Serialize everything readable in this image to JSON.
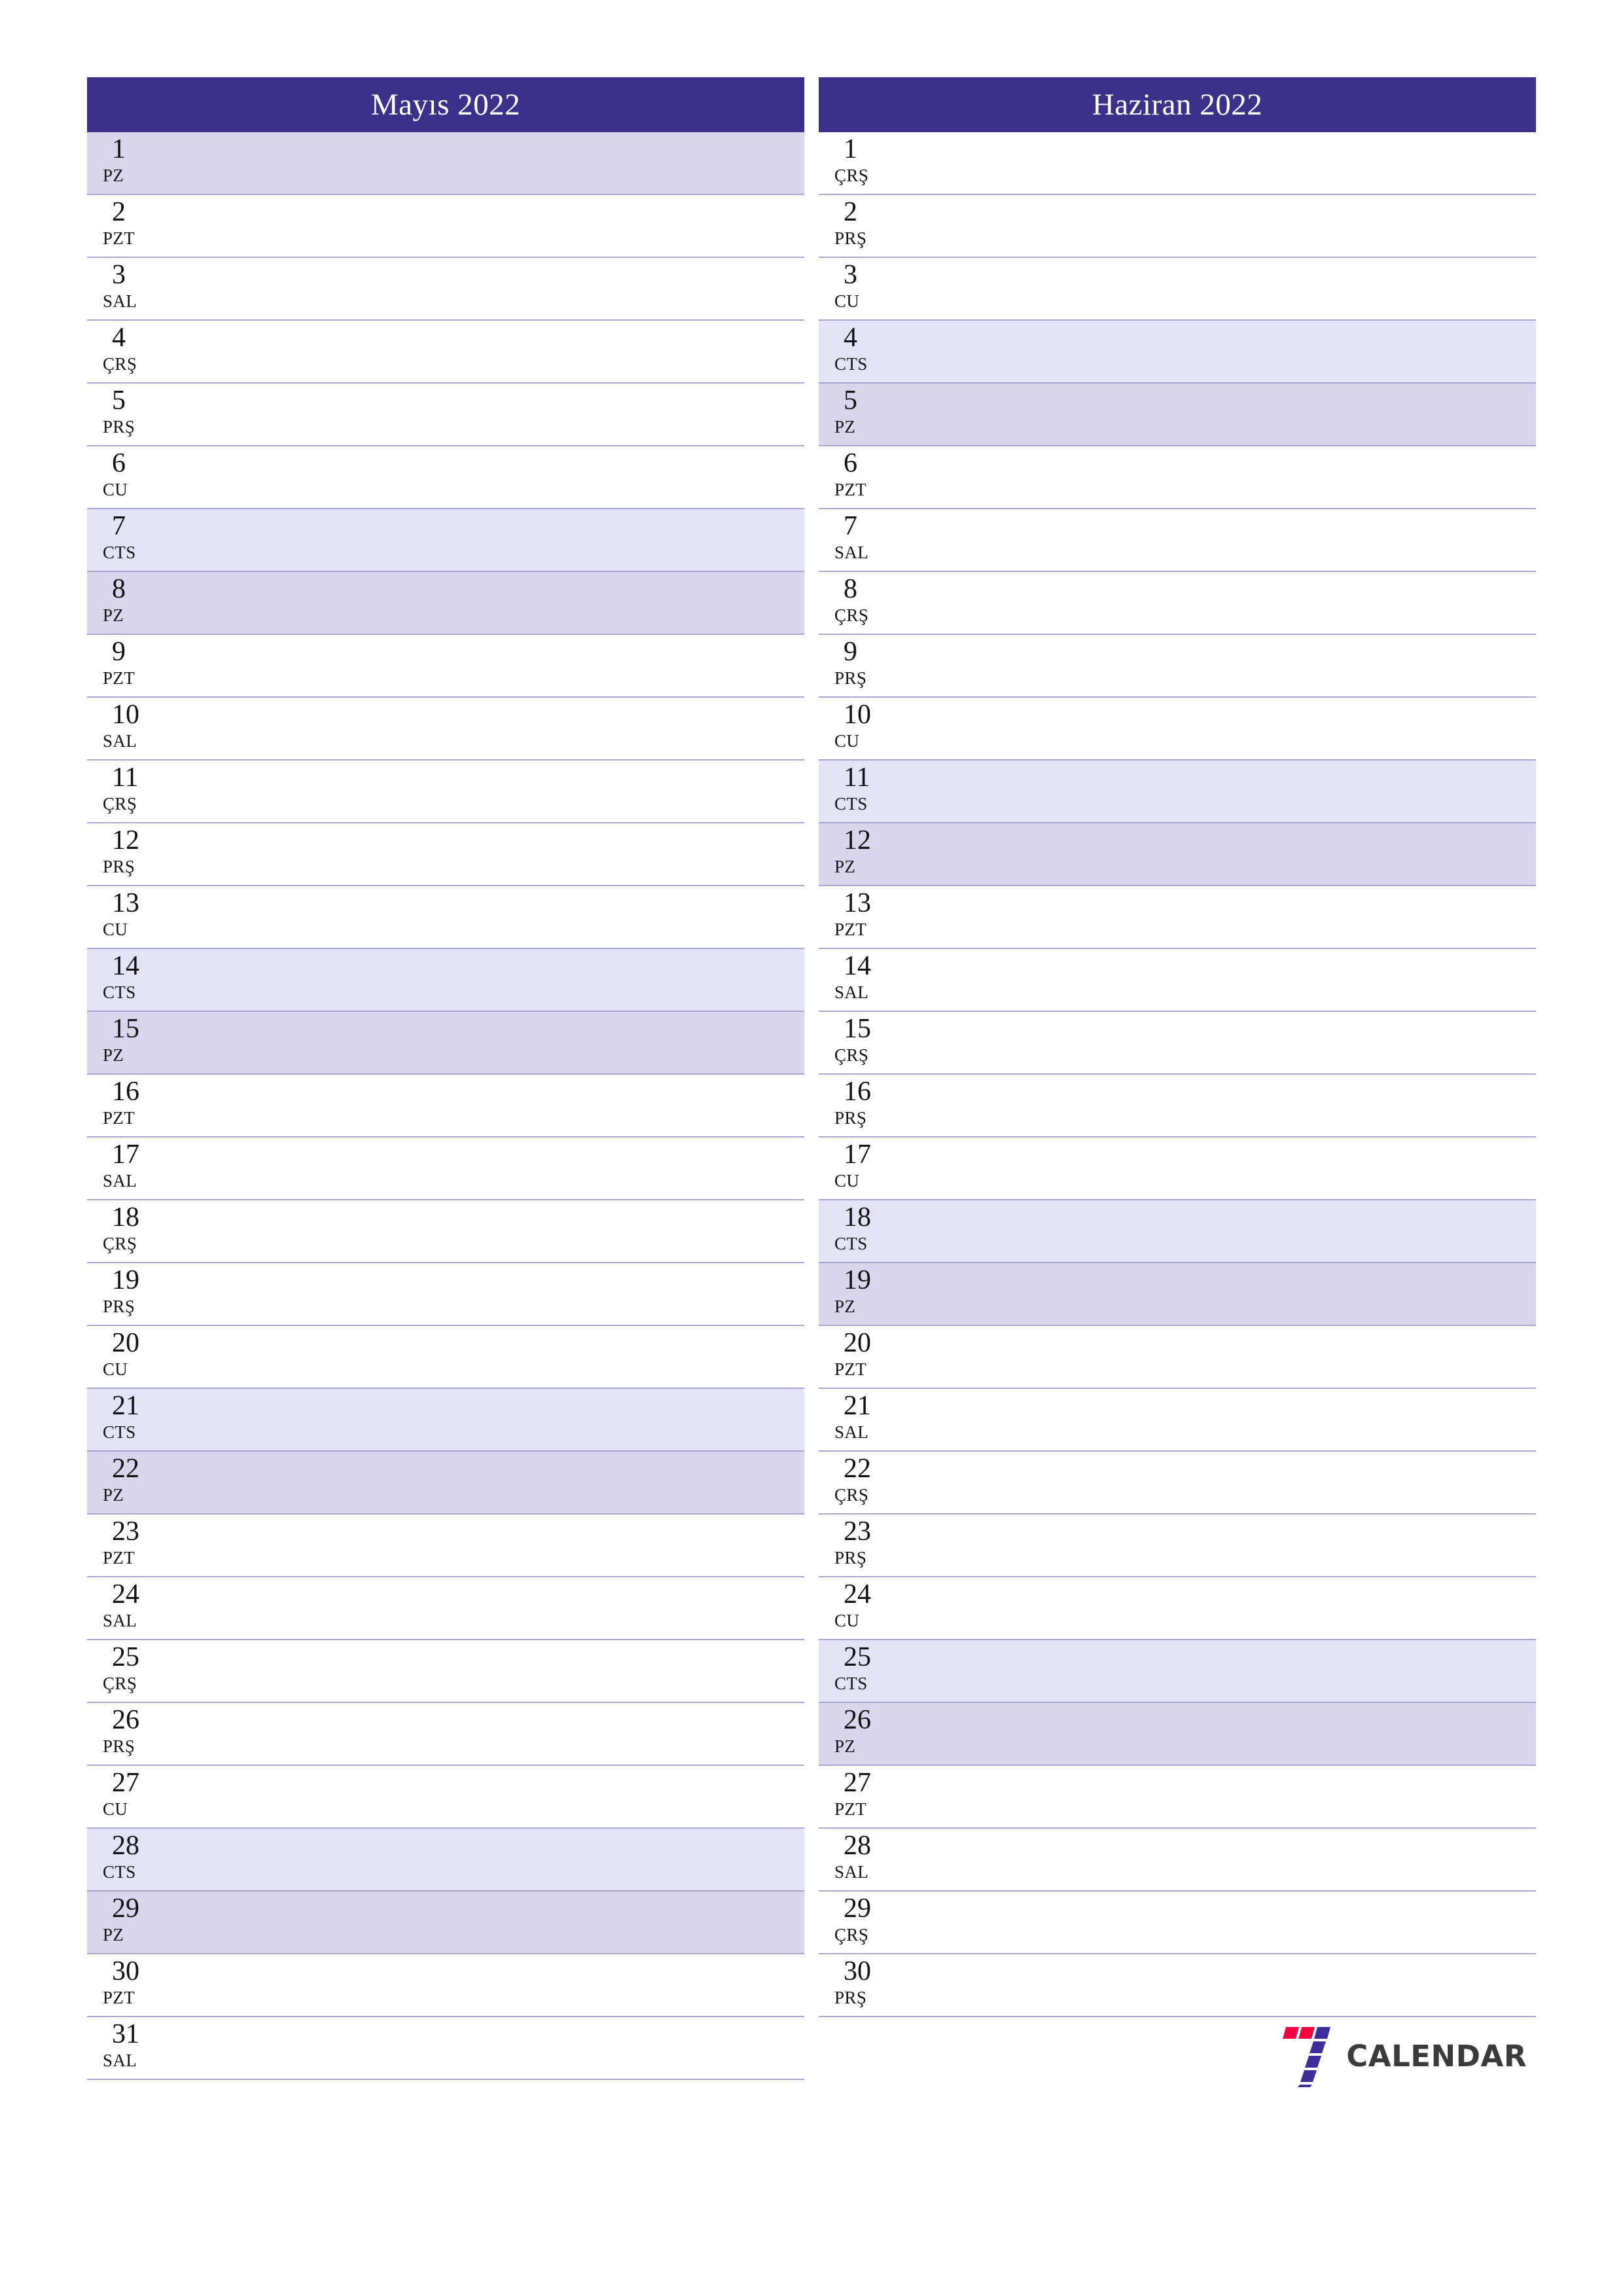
{
  "document": {
    "type": "printable-monthly-planner",
    "orientation": "portrait",
    "language": "tr"
  },
  "colors": {
    "header_band": "#3b3189",
    "header_text": "#ffffff",
    "saturday_fill": "#e3e3f8",
    "sunday_fill": "#d9d5ec",
    "row_rule": "#a9a4cf",
    "page_background": "#ffffff",
    "day_text": "#121212",
    "logo_red": "#f50040",
    "logo_indigo": "#3b2f9c",
    "logo_wordmark": "#3b3b3b"
  },
  "weekday_abbreviations": {
    "sunday": "PZ",
    "monday": "PZT",
    "tuesday": "SAL",
    "wednesday": "ÇRŞ",
    "thursday": "PRŞ",
    "friday": "CU",
    "saturday": "CTS"
  },
  "months": [
    {
      "title": "Mayıs 2022",
      "name": "Mayıs",
      "year": "2022",
      "days": [
        {
          "num": "1",
          "abbr": "PZ",
          "kind": "sun"
        },
        {
          "num": "2",
          "abbr": "PZT",
          "kind": "weekday"
        },
        {
          "num": "3",
          "abbr": "SAL",
          "kind": "weekday"
        },
        {
          "num": "4",
          "abbr": "ÇRŞ",
          "kind": "weekday"
        },
        {
          "num": "5",
          "abbr": "PRŞ",
          "kind": "weekday"
        },
        {
          "num": "6",
          "abbr": "CU",
          "kind": "weekday"
        },
        {
          "num": "7",
          "abbr": "CTS",
          "kind": "sat"
        },
        {
          "num": "8",
          "abbr": "PZ",
          "kind": "sun"
        },
        {
          "num": "9",
          "abbr": "PZT",
          "kind": "weekday"
        },
        {
          "num": "10",
          "abbr": "SAL",
          "kind": "weekday"
        },
        {
          "num": "11",
          "abbr": "ÇRŞ",
          "kind": "weekday"
        },
        {
          "num": "12",
          "abbr": "PRŞ",
          "kind": "weekday"
        },
        {
          "num": "13",
          "abbr": "CU",
          "kind": "weekday"
        },
        {
          "num": "14",
          "abbr": "CTS",
          "kind": "sat"
        },
        {
          "num": "15",
          "abbr": "PZ",
          "kind": "sun"
        },
        {
          "num": "16",
          "abbr": "PZT",
          "kind": "weekday"
        },
        {
          "num": "17",
          "abbr": "SAL",
          "kind": "weekday"
        },
        {
          "num": "18",
          "abbr": "ÇRŞ",
          "kind": "weekday"
        },
        {
          "num": "19",
          "abbr": "PRŞ",
          "kind": "weekday"
        },
        {
          "num": "20",
          "abbr": "CU",
          "kind": "weekday"
        },
        {
          "num": "21",
          "abbr": "CTS",
          "kind": "sat"
        },
        {
          "num": "22",
          "abbr": "PZ",
          "kind": "sun"
        },
        {
          "num": "23",
          "abbr": "PZT",
          "kind": "weekday"
        },
        {
          "num": "24",
          "abbr": "SAL",
          "kind": "weekday"
        },
        {
          "num": "25",
          "abbr": "ÇRŞ",
          "kind": "weekday"
        },
        {
          "num": "26",
          "abbr": "PRŞ",
          "kind": "weekday"
        },
        {
          "num": "27",
          "abbr": "CU",
          "kind": "weekday"
        },
        {
          "num": "28",
          "abbr": "CTS",
          "kind": "sat"
        },
        {
          "num": "29",
          "abbr": "PZ",
          "kind": "sun"
        },
        {
          "num": "30",
          "abbr": "PZT",
          "kind": "weekday"
        },
        {
          "num": "31",
          "abbr": "SAL",
          "kind": "weekday"
        }
      ],
      "has_logo": false
    },
    {
      "title": "Haziran 2022",
      "name": "Haziran",
      "year": "2022",
      "days": [
        {
          "num": "1",
          "abbr": "ÇRŞ",
          "kind": "weekday"
        },
        {
          "num": "2",
          "abbr": "PRŞ",
          "kind": "weekday"
        },
        {
          "num": "3",
          "abbr": "CU",
          "kind": "weekday"
        },
        {
          "num": "4",
          "abbr": "CTS",
          "kind": "sat"
        },
        {
          "num": "5",
          "abbr": "PZ",
          "kind": "sun"
        },
        {
          "num": "6",
          "abbr": "PZT",
          "kind": "weekday"
        },
        {
          "num": "7",
          "abbr": "SAL",
          "kind": "weekday"
        },
        {
          "num": "8",
          "abbr": "ÇRŞ",
          "kind": "weekday"
        },
        {
          "num": "9",
          "abbr": "PRŞ",
          "kind": "weekday"
        },
        {
          "num": "10",
          "abbr": "CU",
          "kind": "weekday"
        },
        {
          "num": "11",
          "abbr": "CTS",
          "kind": "sat"
        },
        {
          "num": "12",
          "abbr": "PZ",
          "kind": "sun"
        },
        {
          "num": "13",
          "abbr": "PZT",
          "kind": "weekday"
        },
        {
          "num": "14",
          "abbr": "SAL",
          "kind": "weekday"
        },
        {
          "num": "15",
          "abbr": "ÇRŞ",
          "kind": "weekday"
        },
        {
          "num": "16",
          "abbr": "PRŞ",
          "kind": "weekday"
        },
        {
          "num": "17",
          "abbr": "CU",
          "kind": "weekday"
        },
        {
          "num": "18",
          "abbr": "CTS",
          "kind": "sat"
        },
        {
          "num": "19",
          "abbr": "PZ",
          "kind": "sun"
        },
        {
          "num": "20",
          "abbr": "PZT",
          "kind": "weekday"
        },
        {
          "num": "21",
          "abbr": "SAL",
          "kind": "weekday"
        },
        {
          "num": "22",
          "abbr": "ÇRŞ",
          "kind": "weekday"
        },
        {
          "num": "23",
          "abbr": "PRŞ",
          "kind": "weekday"
        },
        {
          "num": "24",
          "abbr": "CU",
          "kind": "weekday"
        },
        {
          "num": "25",
          "abbr": "CTS",
          "kind": "sat"
        },
        {
          "num": "26",
          "abbr": "PZ",
          "kind": "sun"
        },
        {
          "num": "27",
          "abbr": "PZT",
          "kind": "weekday"
        },
        {
          "num": "28",
          "abbr": "SAL",
          "kind": "weekday"
        },
        {
          "num": "29",
          "abbr": "ÇRŞ",
          "kind": "weekday"
        },
        {
          "num": "30",
          "abbr": "PRŞ",
          "kind": "weekday"
        }
      ],
      "has_logo": true
    }
  ],
  "branding": {
    "wordmark": "CALENDAR",
    "mark_name": "seven-logo"
  }
}
